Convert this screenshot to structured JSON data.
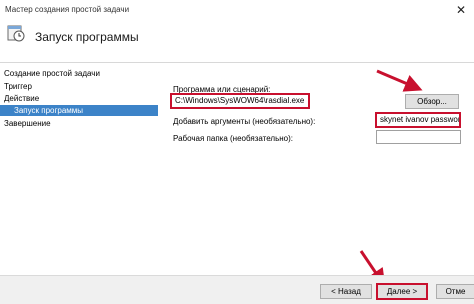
{
  "window": {
    "title": "Мастер создания простой задачи",
    "close_glyph": "✕"
  },
  "header": {
    "title": "Запуск программы",
    "icon": "task-scheduler-icon"
  },
  "sidebar": {
    "items": [
      {
        "label": "Создание простой задачи"
      },
      {
        "label": "Триггер"
      },
      {
        "label": "Действие"
      },
      {
        "label": "Запуск программы",
        "selected": true
      },
      {
        "label": "Завершение"
      }
    ]
  },
  "form": {
    "program_label": "Программа или сценарий:",
    "program_value": "C:\\Windows\\SysWOW64\\rasdial.exe",
    "browse_label": "Обзор...",
    "args_label": "Добавить аргументы (необязательно):",
    "args_value": "skynet ivanov password",
    "workdir_label": "Рабочая папка (необязательно):",
    "workdir_value": ""
  },
  "footer": {
    "back_label": "< Назад",
    "next_label": "Далее >",
    "cancel_label": "Отме"
  },
  "colors": {
    "highlight": "#c8102e",
    "selection": "#3c83c8"
  }
}
